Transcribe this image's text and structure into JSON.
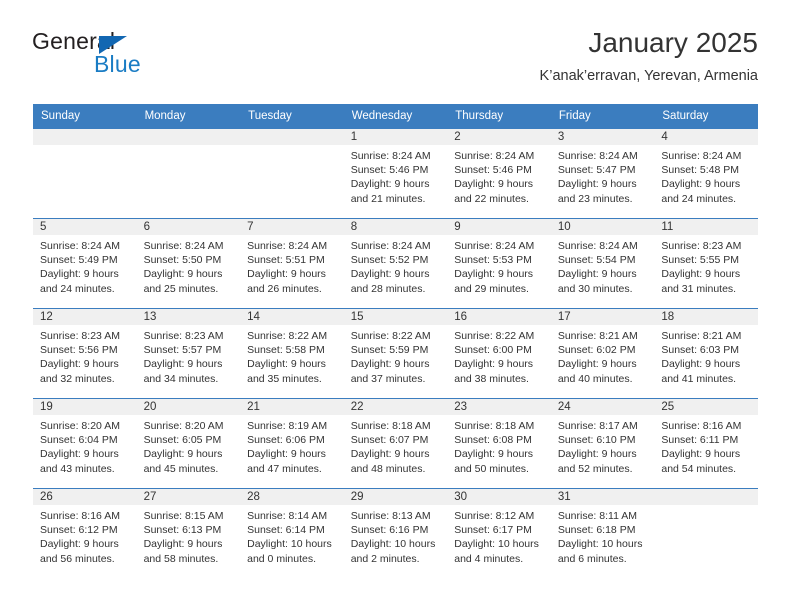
{
  "brand": {
    "name_part1": "General",
    "name_part2": "Blue",
    "triangle_color": "#1267b2",
    "blue_color": "#1a7cc4"
  },
  "header": {
    "title": "January 2025",
    "subtitle": "K’anak’erravan, Yerevan, Armenia"
  },
  "calendar": {
    "header_bg": "#3b7dbf",
    "daynum_band_bg": "#f0f0f0",
    "weekday_headers": [
      "Sunday",
      "Monday",
      "Tuesday",
      "Wednesday",
      "Thursday",
      "Friday",
      "Saturday"
    ],
    "weeks": [
      [
        {
          "day": "",
          "lines": []
        },
        {
          "day": "",
          "lines": []
        },
        {
          "day": "",
          "lines": []
        },
        {
          "day": "1",
          "lines": [
            "Sunrise: 8:24 AM",
            "Sunset: 5:46 PM",
            "Daylight: 9 hours",
            "and 21 minutes."
          ]
        },
        {
          "day": "2",
          "lines": [
            "Sunrise: 8:24 AM",
            "Sunset: 5:46 PM",
            "Daylight: 9 hours",
            "and 22 minutes."
          ]
        },
        {
          "day": "3",
          "lines": [
            "Sunrise: 8:24 AM",
            "Sunset: 5:47 PM",
            "Daylight: 9 hours",
            "and 23 minutes."
          ]
        },
        {
          "day": "4",
          "lines": [
            "Sunrise: 8:24 AM",
            "Sunset: 5:48 PM",
            "Daylight: 9 hours",
            "and 24 minutes."
          ]
        }
      ],
      [
        {
          "day": "5",
          "lines": [
            "Sunrise: 8:24 AM",
            "Sunset: 5:49 PM",
            "Daylight: 9 hours",
            "and 24 minutes."
          ]
        },
        {
          "day": "6",
          "lines": [
            "Sunrise: 8:24 AM",
            "Sunset: 5:50 PM",
            "Daylight: 9 hours",
            "and 25 minutes."
          ]
        },
        {
          "day": "7",
          "lines": [
            "Sunrise: 8:24 AM",
            "Sunset: 5:51 PM",
            "Daylight: 9 hours",
            "and 26 minutes."
          ]
        },
        {
          "day": "8",
          "lines": [
            "Sunrise: 8:24 AM",
            "Sunset: 5:52 PM",
            "Daylight: 9 hours",
            "and 28 minutes."
          ]
        },
        {
          "day": "9",
          "lines": [
            "Sunrise: 8:24 AM",
            "Sunset: 5:53 PM",
            "Daylight: 9 hours",
            "and 29 minutes."
          ]
        },
        {
          "day": "10",
          "lines": [
            "Sunrise: 8:24 AM",
            "Sunset: 5:54 PM",
            "Daylight: 9 hours",
            "and 30 minutes."
          ]
        },
        {
          "day": "11",
          "lines": [
            "Sunrise: 8:23 AM",
            "Sunset: 5:55 PM",
            "Daylight: 9 hours",
            "and 31 minutes."
          ]
        }
      ],
      [
        {
          "day": "12",
          "lines": [
            "Sunrise: 8:23 AM",
            "Sunset: 5:56 PM",
            "Daylight: 9 hours",
            "and 32 minutes."
          ]
        },
        {
          "day": "13",
          "lines": [
            "Sunrise: 8:23 AM",
            "Sunset: 5:57 PM",
            "Daylight: 9 hours",
            "and 34 minutes."
          ]
        },
        {
          "day": "14",
          "lines": [
            "Sunrise: 8:22 AM",
            "Sunset: 5:58 PM",
            "Daylight: 9 hours",
            "and 35 minutes."
          ]
        },
        {
          "day": "15",
          "lines": [
            "Sunrise: 8:22 AM",
            "Sunset: 5:59 PM",
            "Daylight: 9 hours",
            "and 37 minutes."
          ]
        },
        {
          "day": "16",
          "lines": [
            "Sunrise: 8:22 AM",
            "Sunset: 6:00 PM",
            "Daylight: 9 hours",
            "and 38 minutes."
          ]
        },
        {
          "day": "17",
          "lines": [
            "Sunrise: 8:21 AM",
            "Sunset: 6:02 PM",
            "Daylight: 9 hours",
            "and 40 minutes."
          ]
        },
        {
          "day": "18",
          "lines": [
            "Sunrise: 8:21 AM",
            "Sunset: 6:03 PM",
            "Daylight: 9 hours",
            "and 41 minutes."
          ]
        }
      ],
      [
        {
          "day": "19",
          "lines": [
            "Sunrise: 8:20 AM",
            "Sunset: 6:04 PM",
            "Daylight: 9 hours",
            "and 43 minutes."
          ]
        },
        {
          "day": "20",
          "lines": [
            "Sunrise: 8:20 AM",
            "Sunset: 6:05 PM",
            "Daylight: 9 hours",
            "and 45 minutes."
          ]
        },
        {
          "day": "21",
          "lines": [
            "Sunrise: 8:19 AM",
            "Sunset: 6:06 PM",
            "Daylight: 9 hours",
            "and 47 minutes."
          ]
        },
        {
          "day": "22",
          "lines": [
            "Sunrise: 8:18 AM",
            "Sunset: 6:07 PM",
            "Daylight: 9 hours",
            "and 48 minutes."
          ]
        },
        {
          "day": "23",
          "lines": [
            "Sunrise: 8:18 AM",
            "Sunset: 6:08 PM",
            "Daylight: 9 hours",
            "and 50 minutes."
          ]
        },
        {
          "day": "24",
          "lines": [
            "Sunrise: 8:17 AM",
            "Sunset: 6:10 PM",
            "Daylight: 9 hours",
            "and 52 minutes."
          ]
        },
        {
          "day": "25",
          "lines": [
            "Sunrise: 8:16 AM",
            "Sunset: 6:11 PM",
            "Daylight: 9 hours",
            "and 54 minutes."
          ]
        }
      ],
      [
        {
          "day": "26",
          "lines": [
            "Sunrise: 8:16 AM",
            "Sunset: 6:12 PM",
            "Daylight: 9 hours",
            "and 56 minutes."
          ]
        },
        {
          "day": "27",
          "lines": [
            "Sunrise: 8:15 AM",
            "Sunset: 6:13 PM",
            "Daylight: 9 hours",
            "and 58 minutes."
          ]
        },
        {
          "day": "28",
          "lines": [
            "Sunrise: 8:14 AM",
            "Sunset: 6:14 PM",
            "Daylight: 10 hours",
            "and 0 minutes."
          ]
        },
        {
          "day": "29",
          "lines": [
            "Sunrise: 8:13 AM",
            "Sunset: 6:16 PM",
            "Daylight: 10 hours",
            "and 2 minutes."
          ]
        },
        {
          "day": "30",
          "lines": [
            "Sunrise: 8:12 AM",
            "Sunset: 6:17 PM",
            "Daylight: 10 hours",
            "and 4 minutes."
          ]
        },
        {
          "day": "31",
          "lines": [
            "Sunrise: 8:11 AM",
            "Sunset: 6:18 PM",
            "Daylight: 10 hours",
            "and 6 minutes."
          ]
        },
        {
          "day": "",
          "lines": []
        }
      ]
    ]
  }
}
